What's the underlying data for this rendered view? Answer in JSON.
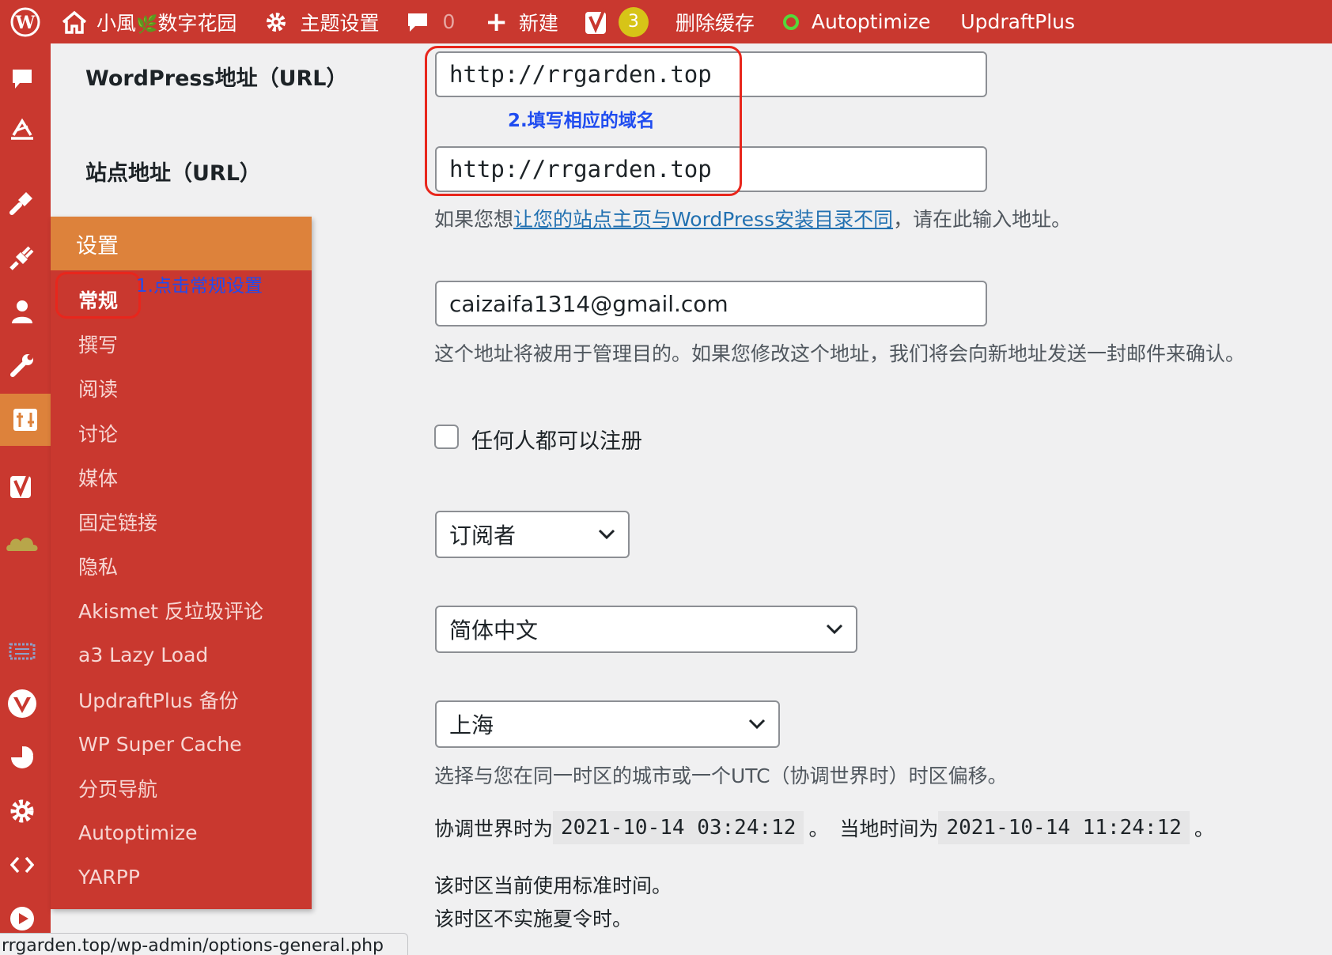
{
  "admin_bar": {
    "site_name": "小風",
    "site_name_suffix": "数字花园",
    "theme_settings": "主题设置",
    "comments_count": "0",
    "new_label": "新建",
    "yoast_badge": "3",
    "clear_cache": "删除缓存",
    "autoptimize": "Autoptimize",
    "updraftplus": "UpdraftPlus",
    "bar_color": "#c9382f"
  },
  "sidebar": {
    "icons": [
      "comments-icon",
      "feedback-icon",
      "appearance-icon",
      "plugins-icon",
      "users-icon",
      "tools-icon",
      "settings-icon",
      "yoast-icon",
      "cloud-icon",
      "network-icon",
      "vector-icon",
      "chart-icon",
      "gear-icon",
      "code-icon",
      "play-icon"
    ],
    "active_color": "#dd823b"
  },
  "submenu": {
    "header": "设置",
    "items": [
      "常规",
      "撰写",
      "阅读",
      "讨论",
      "媒体",
      "固定链接",
      "隐私",
      "Akismet 反垃圾评论",
      "a3 Lazy Load",
      "UpdraftPlus 备份",
      "WP Super Cache",
      "分页导航",
      "Autoptimize",
      "YARPP"
    ],
    "annotation": "1.点击常规设置"
  },
  "form": {
    "wp_url_label": "WordPress地址（URL）",
    "wp_url_value": "http://rrgarden.top",
    "site_url_label": "站点地址（URL）",
    "site_url_value": "http://rrgarden.top",
    "annotation": "2.填写相应的域名",
    "site_url_desc_pre": "如果您想",
    "site_url_desc_link": "让您的站点主页与WordPress安装目录不同",
    "site_url_desc_post": "，请在此输入地址。",
    "email_value": "caizaifa1314@gmail.com",
    "email_desc": "这个地址将被用于管理目的。如果您修改这个地址，我们将会向新地址发送一封邮件来确认。",
    "membership_label": "任何人都可以注册",
    "membership_checked": false,
    "default_role": "订阅者",
    "language": "简体中文",
    "timezone": "上海",
    "timezone_desc": "选择与您在同一时区的城市或一个UTC（协调世界时）时区偏移。",
    "utc_label": "协调世界时为",
    "utc_time": "2021-10-14 03:24:12",
    "sep": "。",
    "local_label": "当地时间为",
    "local_time": "2021-10-14 11:24:12",
    "end": "。",
    "std_time_note": "该时区当前使用标准时间。",
    "dst_note": "该时区不实施夏令时。"
  },
  "status_bar": {
    "url": "rrgarden.top/wp-admin/options-general.php"
  },
  "colors": {
    "annotation_red": "#e8261c",
    "annotation_blue": "#1f4cf0",
    "link_blue": "#2271b1"
  }
}
